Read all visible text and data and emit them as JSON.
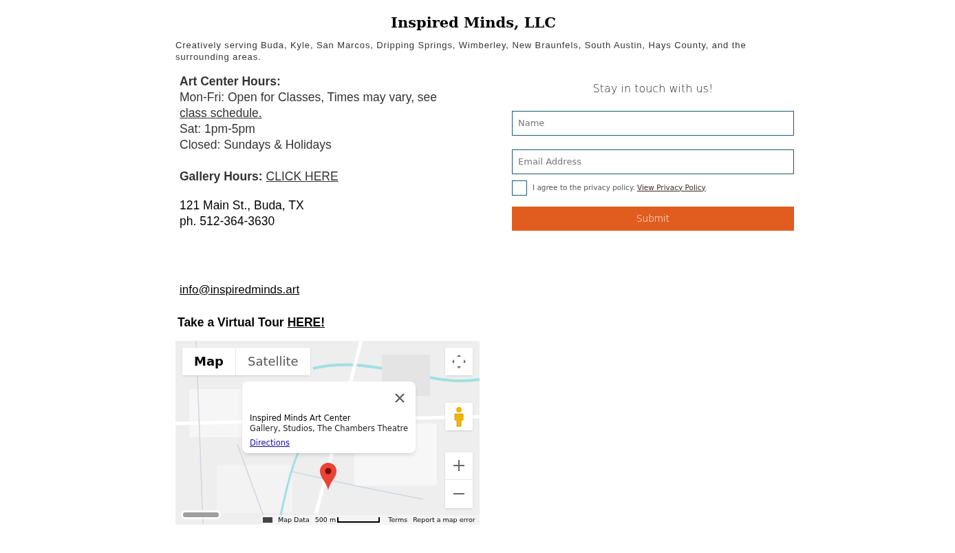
{
  "header": {
    "title": "Inspired Minds, LLC",
    "tagline": "Creatively serving Buda, Kyle, San Marcos, Dripping Springs, Wimberley, New Braunfels, South Austin, Hays County, and the surrounding areas."
  },
  "info": {
    "hours_heading": "Art Center Hours:",
    "weekday_text": "Mon-Fri: Open for Classes, Times may vary, see",
    "schedule_link": "class schedule.",
    "saturday": "Sat: 1pm-5pm",
    "closed": "Closed: Sundays & Holidays",
    "gallery_label": "Gallery Hours:",
    "gallery_link": "CLICK HERE",
    "address": "121 Main St., Buda, TX",
    "phone": "ph. 512-364-3630",
    "email": "info@inspiredminds.art",
    "tour_text": "Take a Virtual Tour",
    "tour_link": "HERE!"
  },
  "map": {
    "map_types": [
      {
        "label": "Map",
        "selected": true
      },
      {
        "label": "Satellite",
        "selected": false
      }
    ],
    "popup": {
      "name": "Inspired Minds Art Center",
      "description": "Gallery, Studios, The Chambers Theatre",
      "link": "Directions"
    },
    "footer": {
      "map_data": "Map Data",
      "scale": "500 m",
      "terms": "Terms",
      "report": "Report a map error"
    }
  },
  "form": {
    "heading": "Stay in touch with us!",
    "fields": [
      {
        "placeholder": "Name"
      },
      {
        "placeholder": "Email Address"
      }
    ],
    "consent": {
      "checked": false,
      "text": "I agree to the privacy policy.",
      "link": "View Privacy Policy"
    },
    "submit": "Submit"
  }
}
